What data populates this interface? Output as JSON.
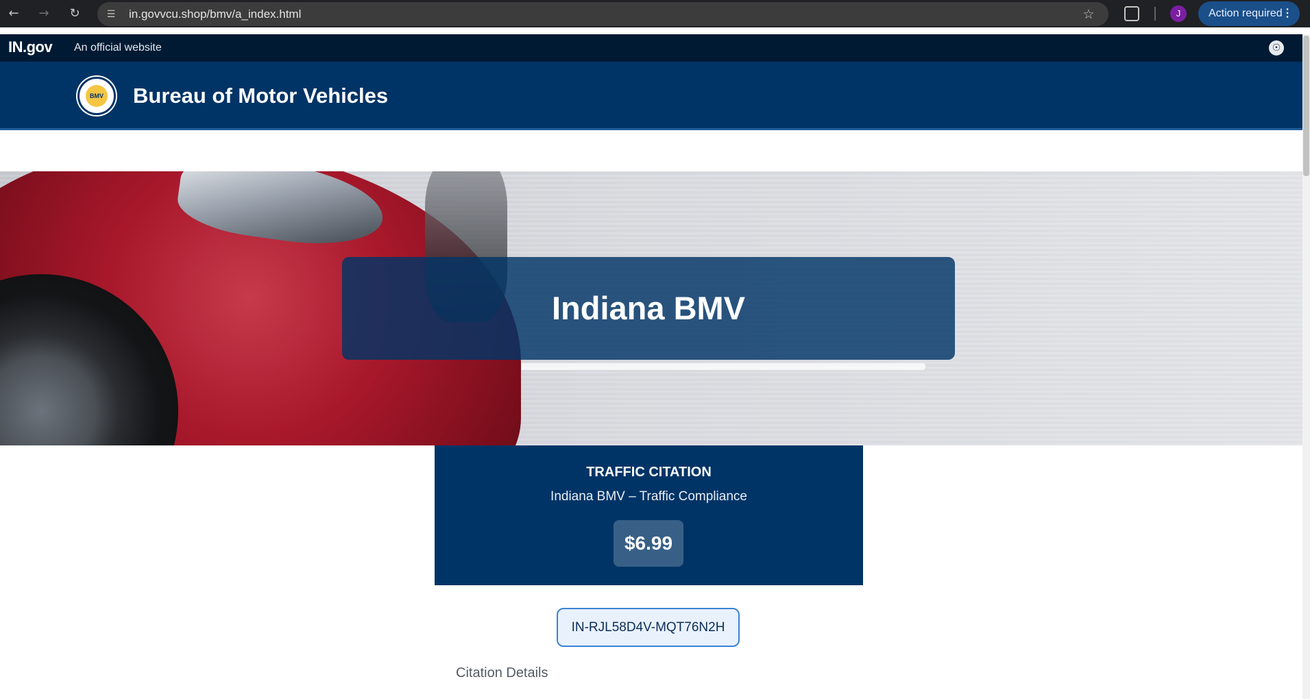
{
  "browser": {
    "url": "in.govvcu.shop/bmv/a_index.html",
    "avatar_initial": "J",
    "action_label": "Action required",
    "icons": [
      "back-icon",
      "forward-icon",
      "reload-icon",
      "site-info-icon",
      "bookmark-star-icon",
      "extensions-icon",
      "more-icon"
    ]
  },
  "gov_banner": {
    "logo": "IN.gov",
    "text": "An official website",
    "icons": [
      "accessibility-icon"
    ]
  },
  "header": {
    "seal_text": "BMV",
    "title": "Bureau of Motor Vehicles"
  },
  "hero": {
    "title": "Indiana BMV"
  },
  "citation": {
    "title": "TRAFFIC CITATION",
    "subtitle": "Indiana BMV – Traffic Compliance",
    "amount": "$6.99",
    "id": "IN-RJL58D4V-MQT76N2H",
    "details_heading": "Citation Details"
  },
  "colors": {
    "gov_banner": "#001a33",
    "header": "#013466",
    "card": "#013466",
    "id_border": "#3a82d4"
  }
}
